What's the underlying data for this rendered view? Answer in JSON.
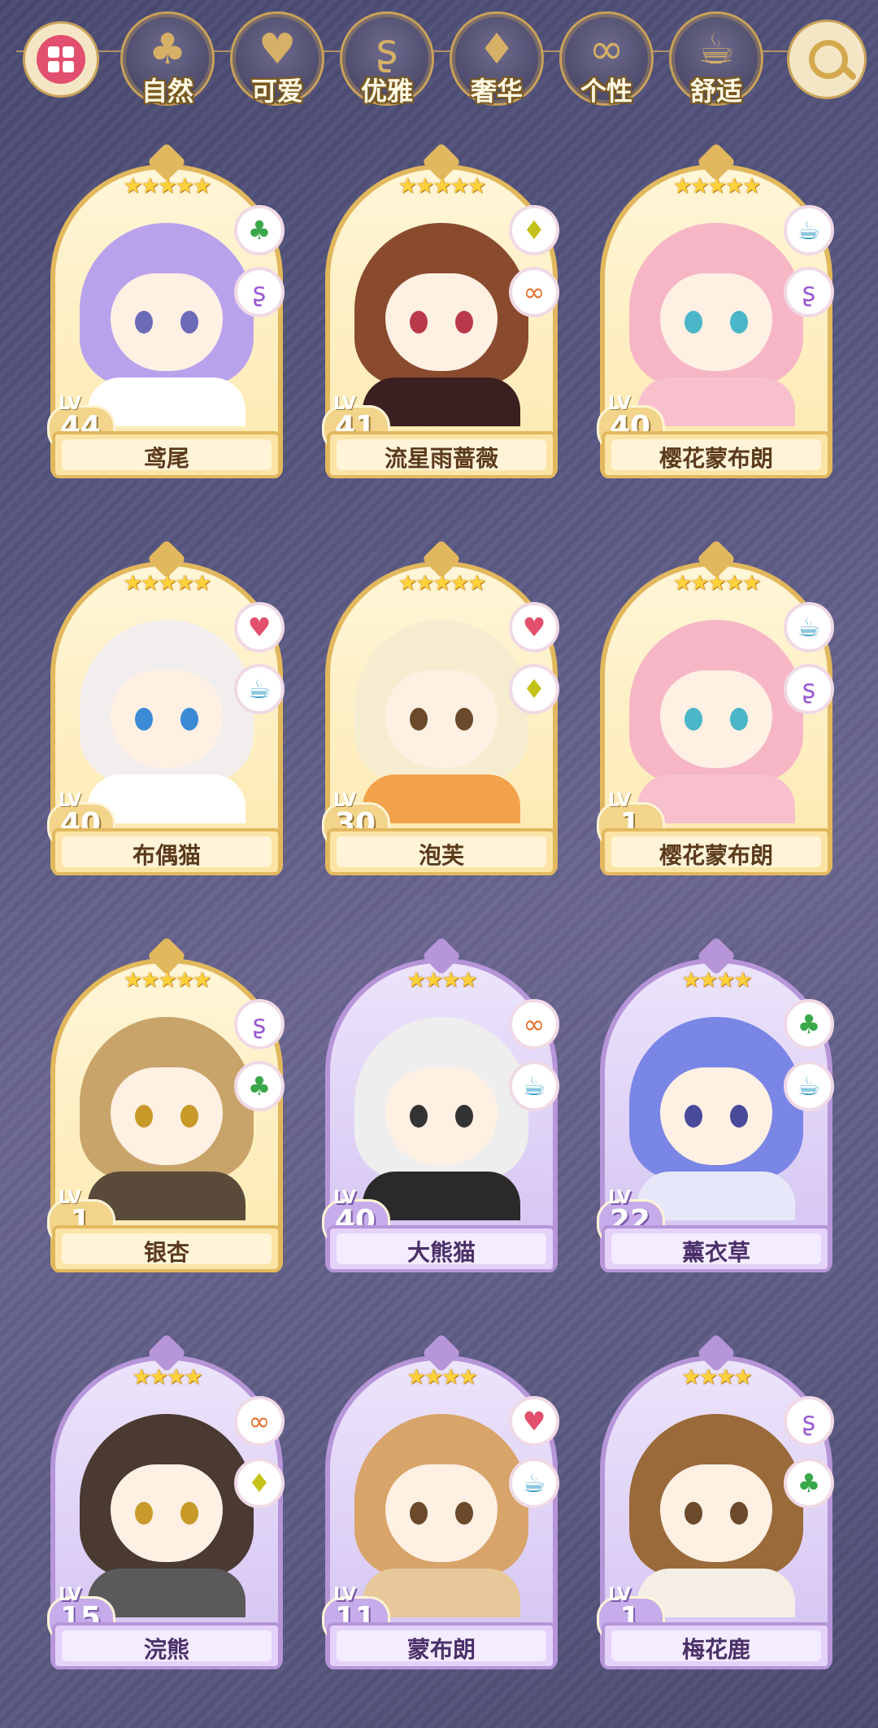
{
  "filters": [
    {
      "label": "自然",
      "icon": "clover-icon",
      "glyph": "♣"
    },
    {
      "label": "可爱",
      "icon": "heart-icon",
      "glyph": "♥"
    },
    {
      "label": "优雅",
      "icon": "swan-icon",
      "glyph": "ʂ"
    },
    {
      "label": "奢华",
      "icon": "diamond-icon",
      "glyph": "♦"
    },
    {
      "label": "个性",
      "icon": "glasses-icon",
      "glyph": "∞"
    },
    {
      "label": "舒适",
      "icon": "teacup-icon",
      "glyph": "☕"
    }
  ],
  "colors": {
    "gold": "#e2b85e",
    "purple": "#b695d8",
    "star": "#ffd23a"
  },
  "lv_label": "LV",
  "cards": [
    {
      "name": "鸢尾",
      "level": "44",
      "stars": "★★★★★",
      "theme": "gold",
      "attrs": [
        "clover-icon",
        "swan-icon"
      ],
      "hair": "#b9a2ec",
      "eye": "#6b6bb8",
      "outfit": "#ffffff"
    },
    {
      "name": "流星雨蔷薇",
      "level": "41",
      "stars": "★★★★★",
      "theme": "gold",
      "attrs": [
        "diamond-icon",
        "glasses-icon"
      ],
      "hair": "#8a4a2e",
      "eye": "#b83a4a",
      "outfit": "#3a2020"
    },
    {
      "name": "樱花蒙布朗",
      "level": "40",
      "stars": "★★★★★",
      "theme": "gold",
      "attrs": [
        "teacup-icon",
        "swan-icon"
      ],
      "hair": "#f6b6c6",
      "eye": "#4ab6c8",
      "outfit": "#f7c0cc"
    },
    {
      "name": "布偶猫",
      "level": "40",
      "stars": "★★★★★",
      "theme": "gold",
      "attrs": [
        "heart-icon",
        "teacup-icon"
      ],
      "hair": "#f2eeee",
      "eye": "#3a8ad6",
      "outfit": "#ffffff"
    },
    {
      "name": "泡芙",
      "level": "30",
      "stars": "★★★★★",
      "theme": "gold",
      "attrs": [
        "heart-icon",
        "diamond-icon"
      ],
      "hair": "#f6ecd0",
      "eye": "#6a4a2a",
      "outfit": "#f2a24a"
    },
    {
      "name": "樱花蒙布朗",
      "level": "1",
      "stars": "★★★★★",
      "theme": "gold",
      "attrs": [
        "teacup-icon",
        "swan-icon"
      ],
      "hair": "#f6b6c6",
      "eye": "#4ab6c8",
      "outfit": "#f7c0cc"
    },
    {
      "name": "银杏",
      "level": "1",
      "stars": "★★★★★",
      "theme": "gold",
      "attrs": [
        "swan-icon",
        "clover-icon"
      ],
      "hair": "#c8a46a",
      "eye": "#c89a2a",
      "outfit": "#5a4a3a"
    },
    {
      "name": "大熊猫",
      "level": "40",
      "stars": "★★★★",
      "theme": "purple",
      "attrs": [
        "glasses-icon",
        "teacup-icon"
      ],
      "hair": "#eeeeee",
      "eye": "#333333",
      "outfit": "#2a2a2a"
    },
    {
      "name": "薰衣草",
      "level": "22",
      "stars": "★★★★",
      "theme": "purple",
      "attrs": [
        "clover-icon",
        "teacup-icon"
      ],
      "hair": "#7a86e6",
      "eye": "#4a4a9a",
      "outfit": "#e6e8fa"
    },
    {
      "name": "浣熊",
      "level": "15",
      "stars": "★★★★",
      "theme": "purple",
      "attrs": [
        "glasses-icon",
        "diamond-icon"
      ],
      "hair": "#4a3a32",
      "eye": "#c89a2a",
      "outfit": "#5a5a5a"
    },
    {
      "name": "蒙布朗",
      "level": "11",
      "stars": "★★★★",
      "theme": "purple",
      "attrs": [
        "heart-icon",
        "teacup-icon"
      ],
      "hair": "#d8a46a",
      "eye": "#6a4a2a",
      "outfit": "#e6c89a"
    },
    {
      "name": "梅花鹿",
      "level": "1",
      "stars": "★★★★",
      "theme": "purple",
      "attrs": [
        "swan-icon",
        "clover-icon"
      ],
      "hair": "#9a6a3a",
      "eye": "#6a4a2a",
      "outfit": "#f4eee6"
    }
  ]
}
